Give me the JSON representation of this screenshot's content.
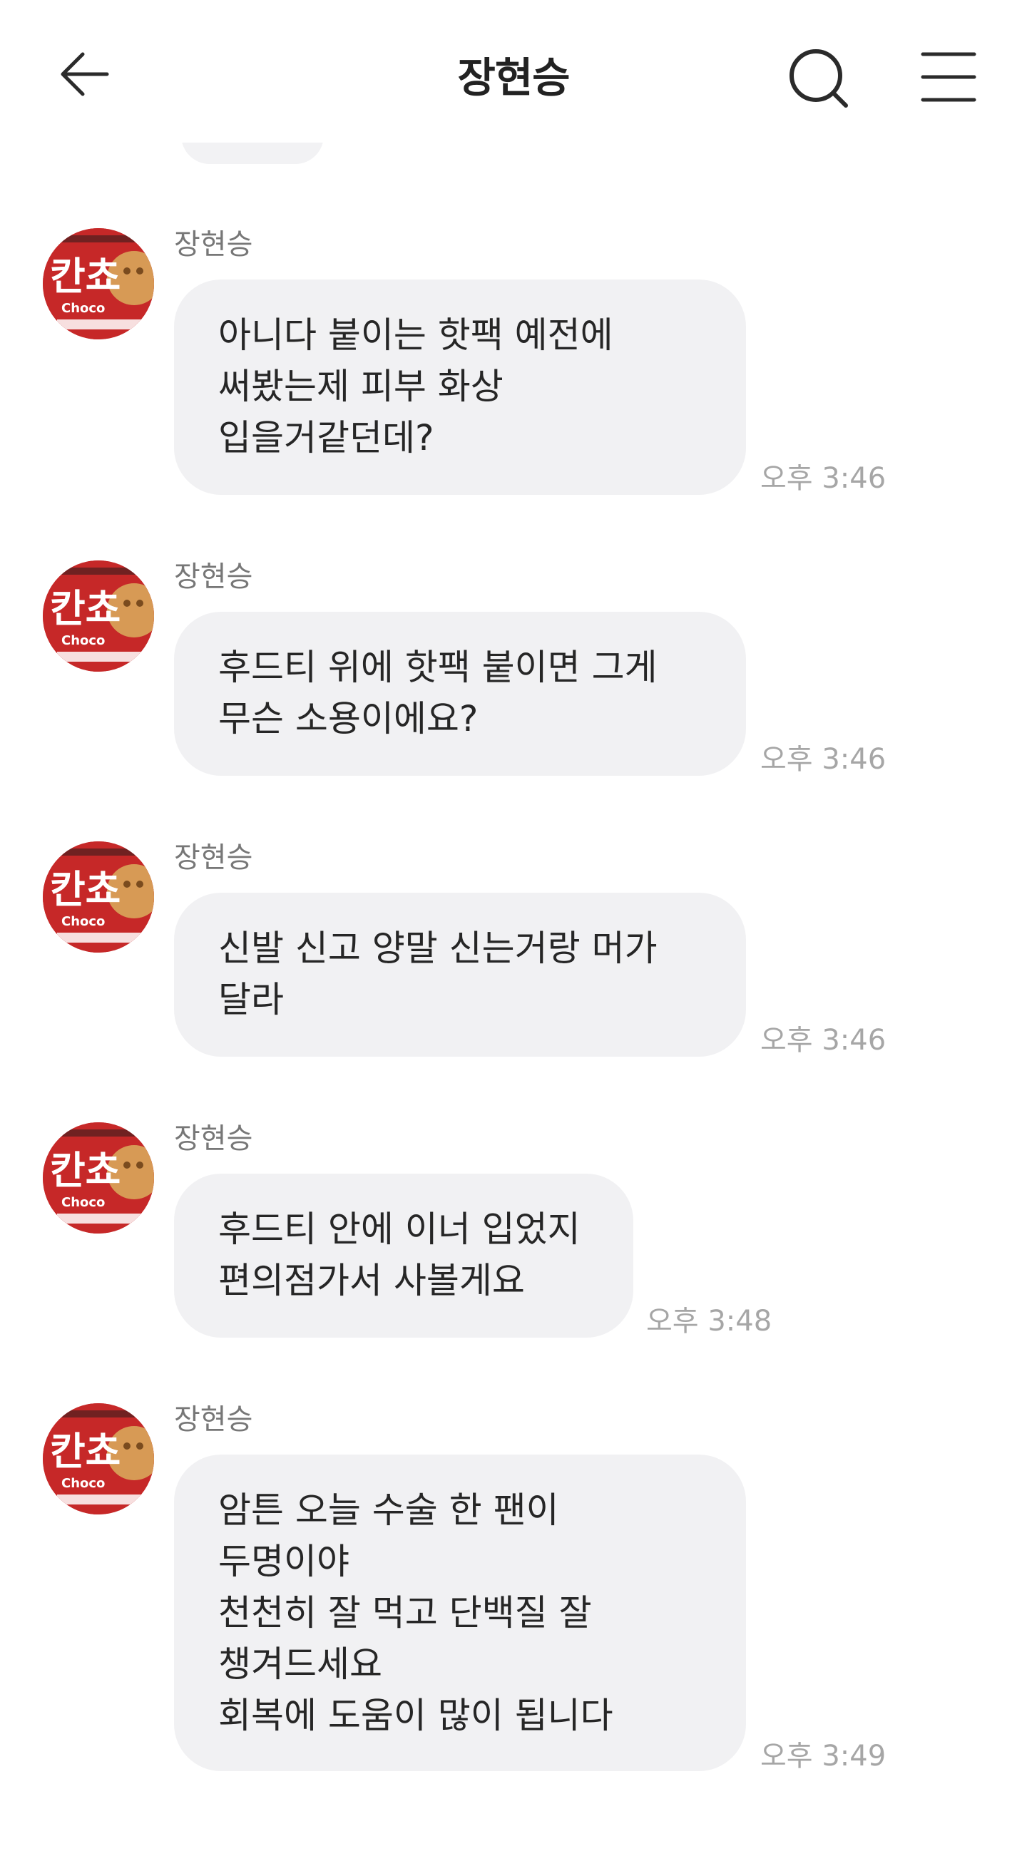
{
  "header": {
    "title": "장현승",
    "back_icon": "back-arrow-icon",
    "search_icon": "search-icon",
    "menu_icon": "hamburger-menu-icon"
  },
  "messages": [
    {
      "sender": "장현승",
      "lines": [
        "아니다 붙이는 핫팩 예전에",
        "써봤는제 피부 화상",
        "입을거같던데?"
      ],
      "time": "오후 3:46"
    },
    {
      "sender": "장현승",
      "lines": [
        "후드티 위에 핫팩 붙이면 그게",
        "무슨 소용이에요?"
      ],
      "time": "오후 3:46"
    },
    {
      "sender": "장현승",
      "lines": [
        "신발 신고 양말 신는거랑 머가",
        "달라"
      ],
      "time": "오후 3:46"
    },
    {
      "sender": "장현승",
      "lines": [
        "후드티 안에 이너 입었지",
        "편의점가서 사볼게요"
      ],
      "time": "오후 3:48"
    },
    {
      "sender": "장현승",
      "lines": [
        "암튼 오늘 수술 한 팬이",
        "두명이야",
        "천천히 잘 먹고 단백질 잘",
        "챙겨드세요",
        "회복에 도움이 많이 됩니다"
      ],
      "time": "오후 3:49"
    }
  ],
  "avatar": {
    "brand_text": "Choco",
    "logo_text": "칸쵸",
    "colors": {
      "primary": "#c62828",
      "biscuit": "#d79a55"
    }
  },
  "colors": {
    "bubble": "#f1f1f3",
    "timestamp": "#a6a6a6",
    "sender": "#777777"
  }
}
